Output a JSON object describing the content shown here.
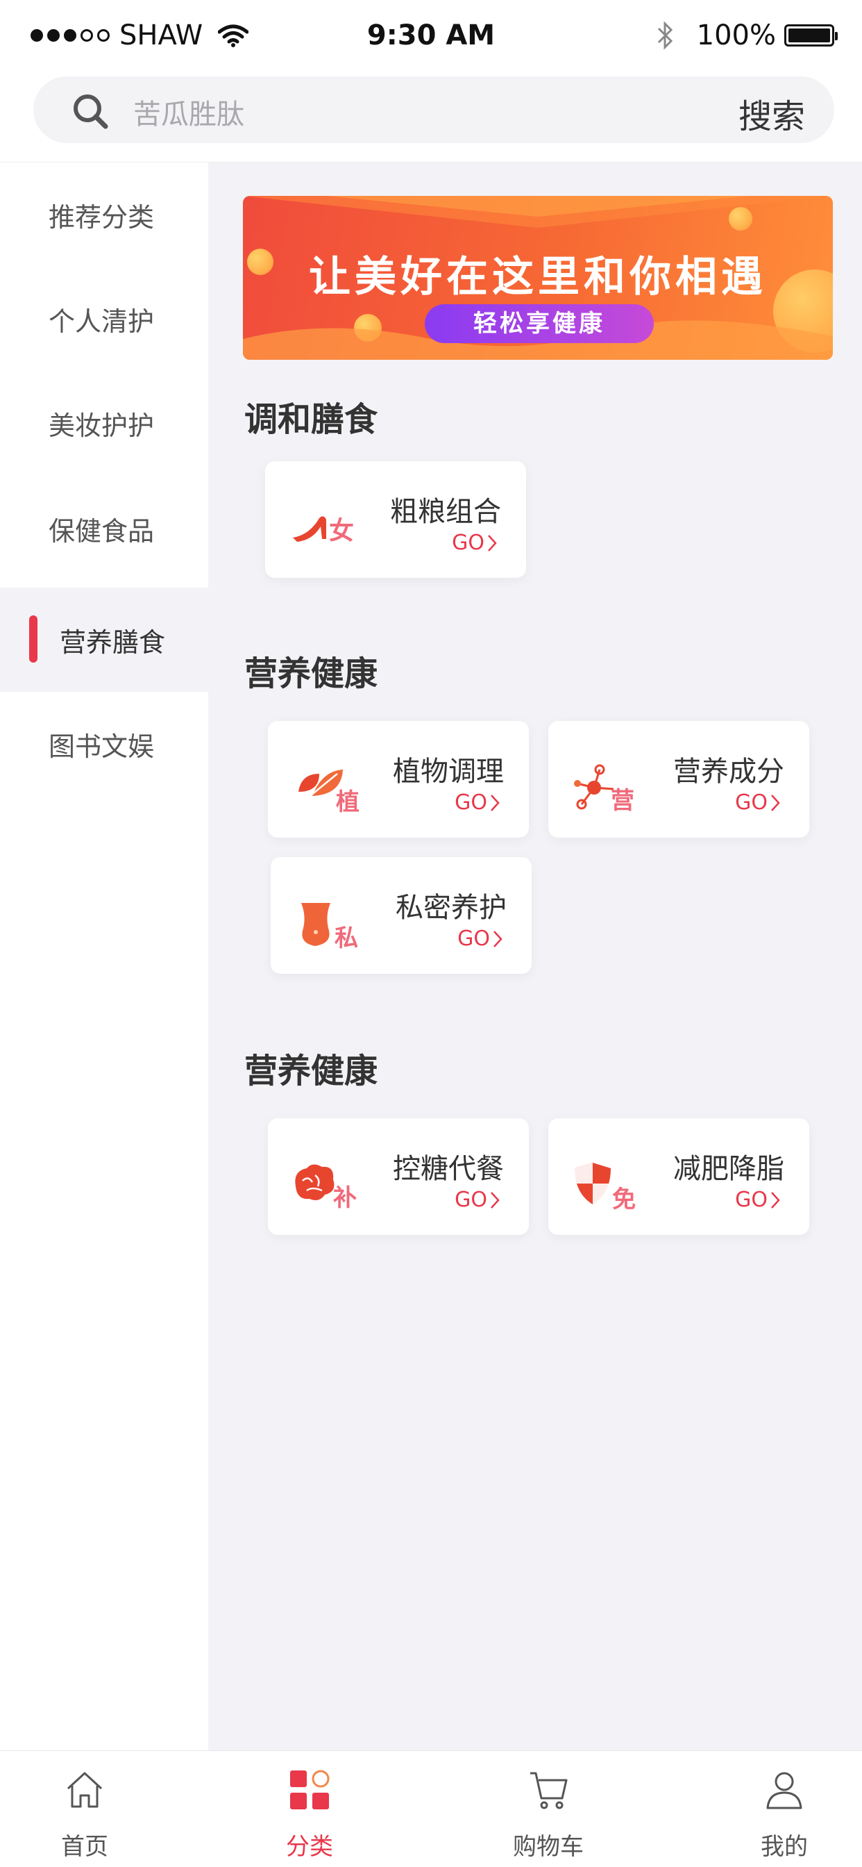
{
  "status_bar": {
    "carrier": "SHAW",
    "time": "9:30 AM",
    "battery": "100%"
  },
  "search": {
    "placeholder": "苦瓜胜肽",
    "button_label": "搜索"
  },
  "sidebar": {
    "items": [
      {
        "label": "推荐分类",
        "active": false
      },
      {
        "label": "个人清护",
        "active": false
      },
      {
        "label": "美妆护护",
        "active": false
      },
      {
        "label": "保健食品",
        "active": false
      },
      {
        "label": "营养膳食",
        "active": true
      },
      {
        "label": "图书文娱",
        "active": false
      }
    ]
  },
  "banner": {
    "title": "让美好在这里和你相遇",
    "subtitle": "轻松享健康"
  },
  "sections": [
    {
      "title": "调和膳食",
      "cards": [
        {
          "label": "粗粮组合",
          "go": "GO",
          "icon": "high-heel-icon"
        }
      ]
    },
    {
      "title": "营养健康",
      "cards": [
        {
          "label": "植物调理",
          "go": "GO",
          "icon": "leaf-icon"
        },
        {
          "label": "营养成分",
          "go": "GO",
          "icon": "molecule-icon"
        },
        {
          "label": "私密养护",
          "go": "GO",
          "icon": "body-icon"
        }
      ]
    },
    {
      "title": "营养健康",
      "cards": [
        {
          "label": "控糖代餐",
          "go": "GO",
          "icon": "brain-icon"
        },
        {
          "label": "减肥降脂",
          "go": "GO",
          "icon": "shield-icon"
        }
      ]
    }
  ],
  "tab_bar": {
    "tabs": [
      {
        "label": "首页",
        "icon": "home-icon",
        "active": false
      },
      {
        "label": "分类",
        "icon": "category-icon",
        "active": true
      },
      {
        "label": "购物车",
        "icon": "cart-icon",
        "active": false
      },
      {
        "label": "我的",
        "icon": "profile-icon",
        "active": false
      }
    ]
  },
  "colors": {
    "accent": "#e8384a",
    "page_bg": "#f3f3f7",
    "banner_start": "#f04b3c",
    "banner_end": "#ff8f3a"
  }
}
